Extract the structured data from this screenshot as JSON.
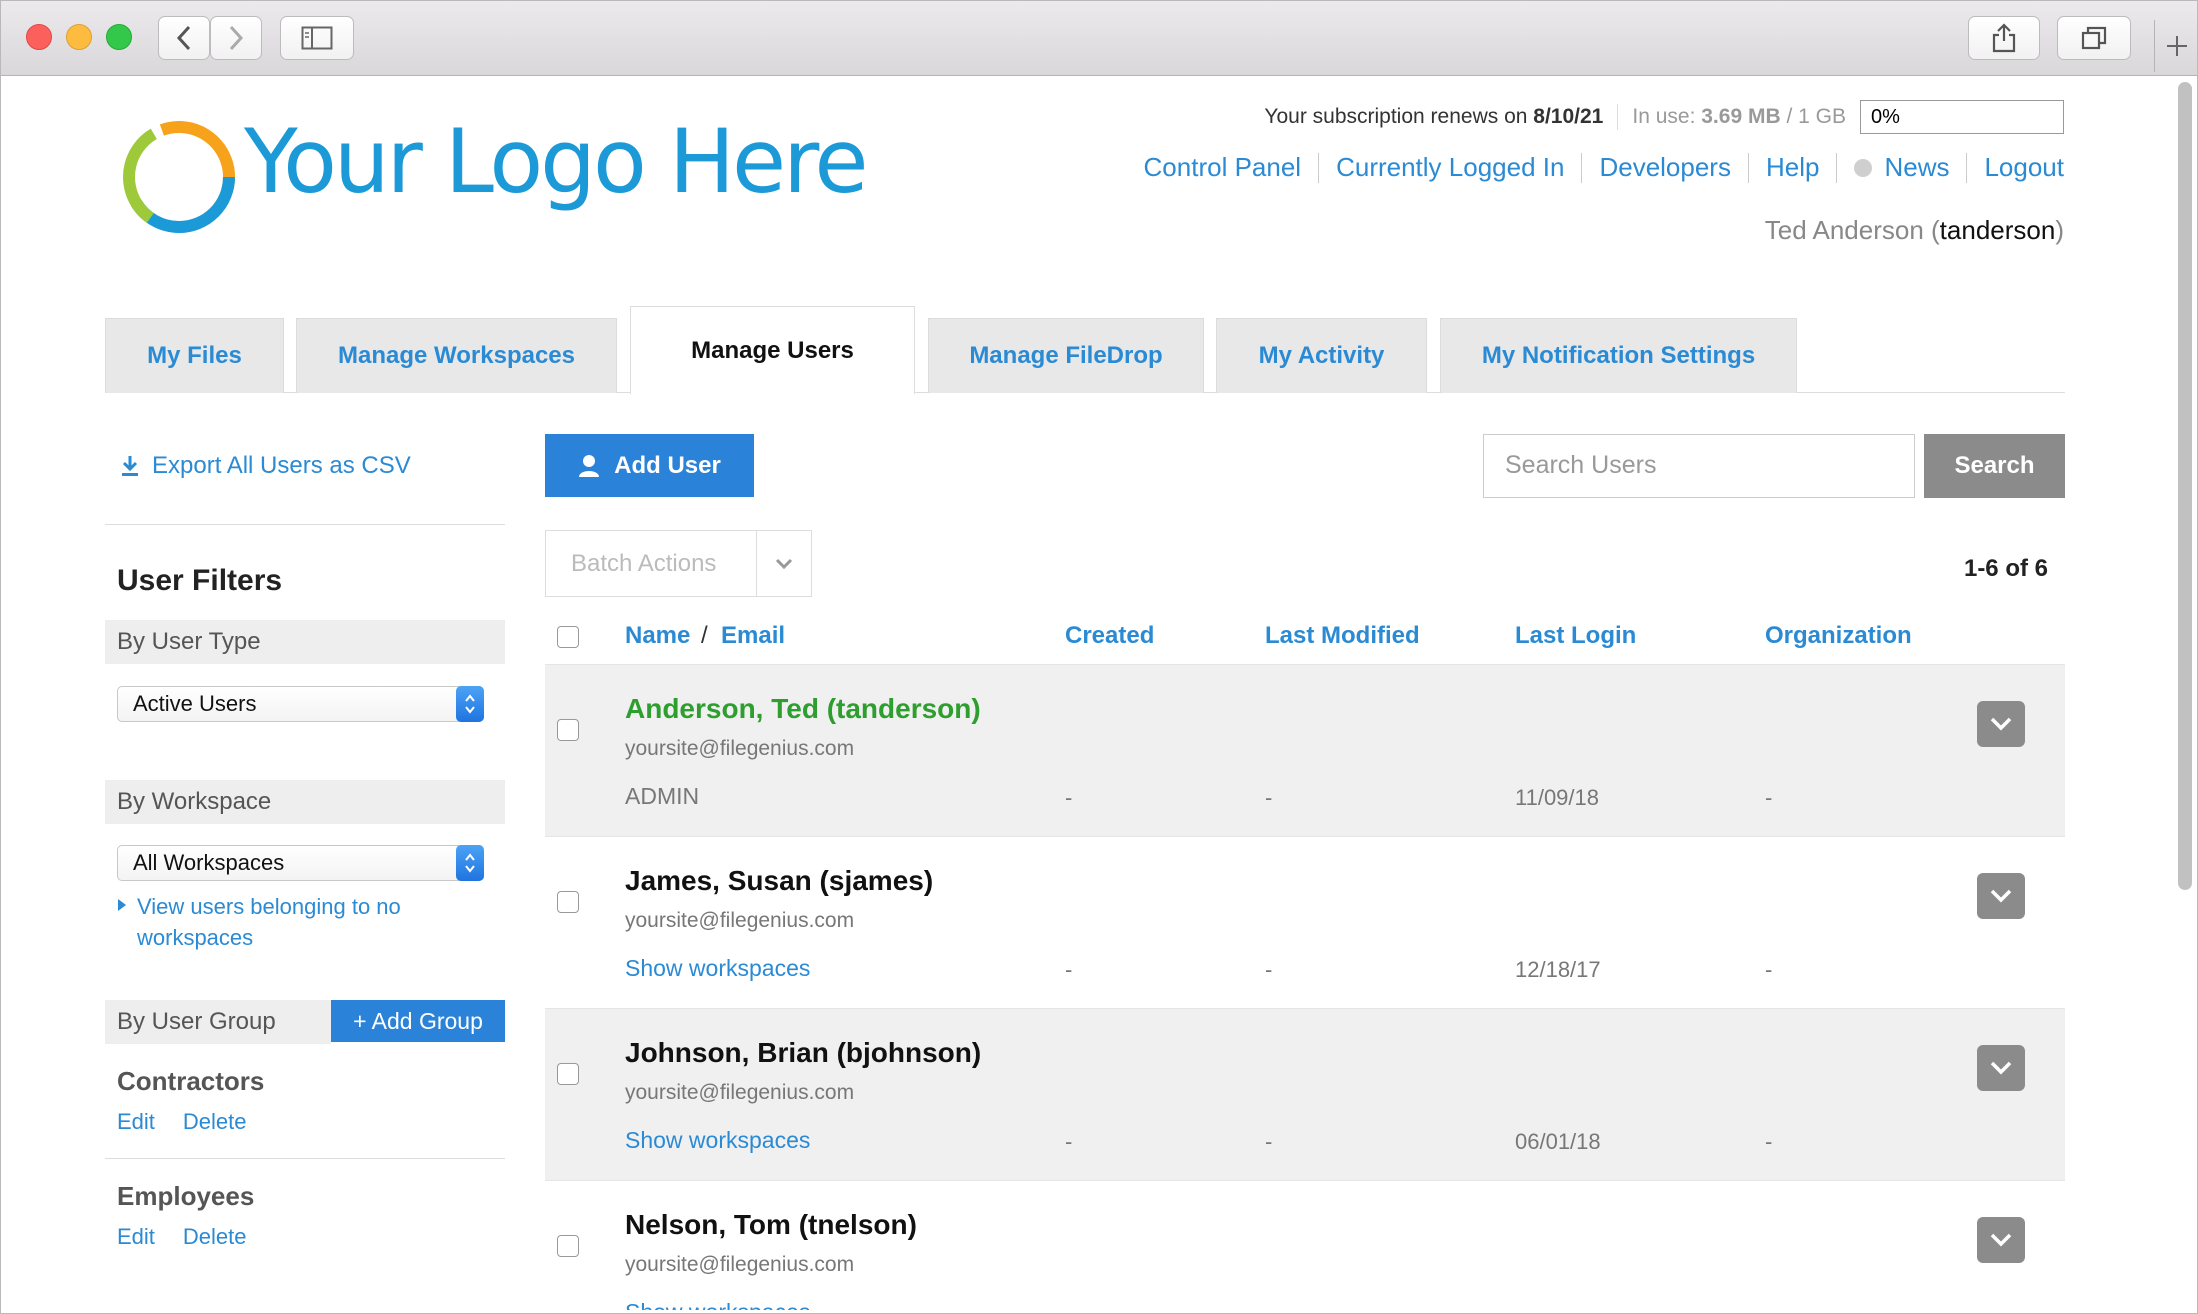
{
  "header": {
    "logo_text": "Your Logo Here",
    "subscription_prefix": "Your subscription renews on",
    "subscription_date": "8/10/21",
    "usage_prefix": "In use:",
    "usage_value": "3.69 MB",
    "usage_total": "/ 1 GB",
    "quota_percent": "0%",
    "nav": [
      "Control Panel",
      "Currently Logged In",
      "Developers",
      "Help",
      "News",
      "Logout"
    ],
    "user_full_name": "Ted Anderson",
    "user_login": "tanderson"
  },
  "tabs": [
    {
      "label": "My Files"
    },
    {
      "label": "Manage Workspaces"
    },
    {
      "label": "Manage Users"
    },
    {
      "label": "Manage FileDrop"
    },
    {
      "label": "My Activity"
    },
    {
      "label": "My Notification Settings"
    }
  ],
  "sidebar": {
    "export_label": "Export All Users as CSV",
    "filters_title": "User Filters",
    "by_user_type": "By User Type",
    "user_type_value": "Active Users",
    "by_workspace": "By Workspace",
    "workspace_value": "All Workspaces",
    "no_workspace_link_1": "View users belonging to no",
    "no_workspace_link_2": "workspaces",
    "by_user_group": "By User Group",
    "add_group_label": "+ Add Group",
    "groups": [
      {
        "name": "Contractors",
        "edit": "Edit",
        "delete": "Delete"
      },
      {
        "name": "Employees",
        "edit": "Edit",
        "delete": "Delete"
      }
    ]
  },
  "main": {
    "add_user_label": "Add User",
    "search_placeholder": "Search Users",
    "search_button": "Search",
    "batch_actions": "Batch Actions",
    "pagination": "1-6 of 6",
    "columns": {
      "name": "Name",
      "slash": "/",
      "email": "Email",
      "created": "Created",
      "last_modified": "Last Modified",
      "last_login": "Last Login",
      "organization": "Organization"
    },
    "rows": [
      {
        "name": "Anderson, Ted (tanderson)",
        "email": "yoursite@filegenius.com",
        "sub": "ADMIN",
        "created": "-",
        "modified": "-",
        "last_login": "11/09/18",
        "org": "-"
      },
      {
        "name": "James, Susan (sjames)",
        "email": "yoursite@filegenius.com",
        "sub": "Show workspaces",
        "created": "-",
        "modified": "-",
        "last_login": "12/18/17",
        "org": "-"
      },
      {
        "name": "Johnson, Brian (bjohnson)",
        "email": "yoursite@filegenius.com",
        "sub": "Show workspaces",
        "created": "-",
        "modified": "-",
        "last_login": "06/01/18",
        "org": "-"
      },
      {
        "name": "Nelson, Tom (tnelson)",
        "email": "yoursite@filegenius.com",
        "sub": "Show workspaces",
        "created": "",
        "modified": "",
        "last_login": "",
        "org": ""
      }
    ]
  },
  "colors": {
    "link_blue": "#2a8ad4",
    "button_blue": "#2a83d8",
    "current_user_green": "#2e9e2e",
    "gray_button": "#8b8b8b"
  }
}
